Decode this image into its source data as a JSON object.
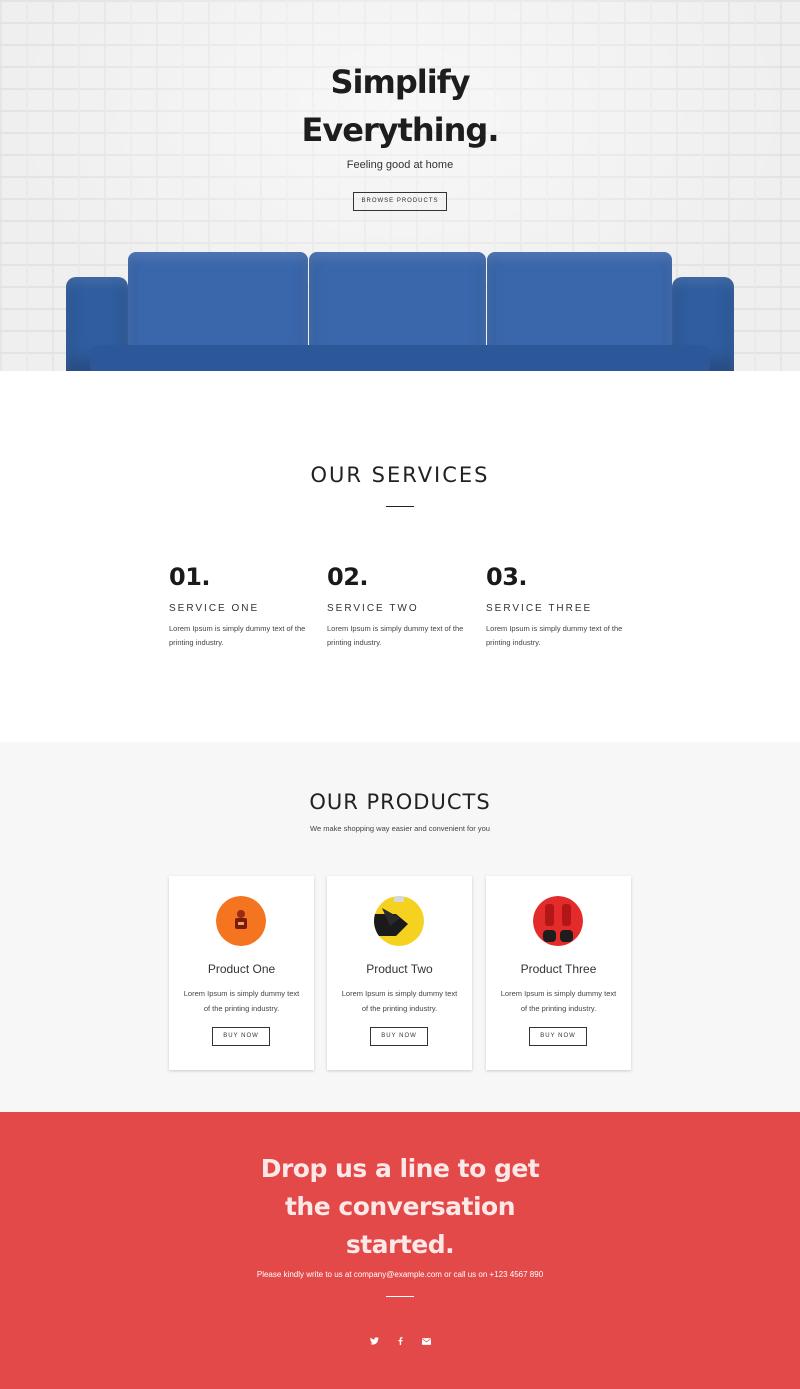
{
  "hero": {
    "title_line1": "Simplify",
    "title_line2": "Everything.",
    "subtitle": "Feeling good at home",
    "button_label": "BROWSE PRODUCTS"
  },
  "services": {
    "title": "OUR SERVICES",
    "items": [
      {
        "number": "01.",
        "name": "SERVICE ONE",
        "desc_line1": "Lorem Ipsum is simply dummy text of the",
        "desc_line2": "printing industry."
      },
      {
        "number": "02.",
        "name": "SERVICE TWO",
        "desc_line1": "Lorem Ipsum is simply dummy text of the",
        "desc_line2": "printing industry."
      },
      {
        "number": "03.",
        "name": "SERVICE THREE",
        "desc_line1": "Lorem Ipsum is simply dummy text of the",
        "desc_line2": "printing industry."
      }
    ]
  },
  "products": {
    "title": "OUR PRODUCTS",
    "subtitle": "We make shopping way easier and convenient for you",
    "items": [
      {
        "name": "Product One",
        "desc_line1": "Lorem Ipsum is simply dummy text",
        "desc_line2": "of the printing industry.",
        "button_label": "BUY NOW",
        "image": "orange-product-thumbnail"
      },
      {
        "name": "Product Two",
        "desc_line1": "Lorem Ipsum is simply dummy text",
        "desc_line2": "of the printing industry.",
        "button_label": "BUY NOW",
        "image": "yellow-product-thumbnail"
      },
      {
        "name": "Product Three",
        "desc_line1": "Lorem Ipsum is simply dummy text",
        "desc_line2": "of the printing industry.",
        "button_label": "BUY NOW",
        "image": "red-product-thumbnail"
      }
    ]
  },
  "contact": {
    "title_line1": "Drop us a line to get",
    "title_line2": "the conversation",
    "title_line3": "started.",
    "subtitle": "Please kindly write to us at company@example.com or call us on +123 4567 890",
    "socials": [
      "twitter-icon",
      "facebook-icon",
      "email-icon"
    ]
  },
  "colors": {
    "sofa_blue": "#3a67ac",
    "contact_red": "#e34949",
    "products_bg": "#f7f7f7",
    "text_dark": "#222222"
  }
}
